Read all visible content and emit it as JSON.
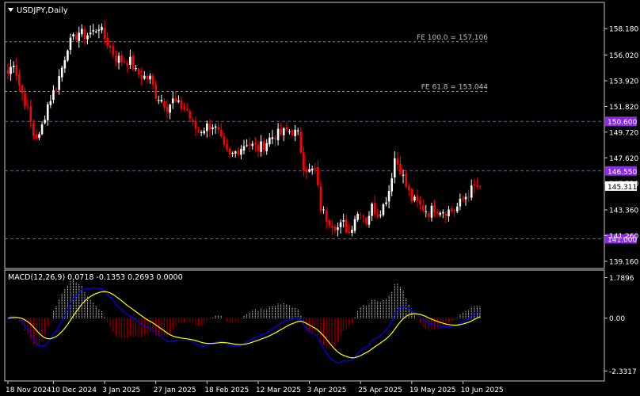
{
  "symbol_title": "USDJPY,Daily",
  "macd_title": "MACD(12,26,9) 0.0718 -0.1353 0.2693 0.0000",
  "colors": {
    "background": "#000000",
    "frame": "#c8c8c8",
    "bull_candle": "#ffffff",
    "bear_candle": "#ff0000",
    "level_line": "#9a34d6",
    "level_label_bg": "#8a2be2",
    "fib_line": "#8c8c8c",
    "macd_line": "#0000ff",
    "signal_line": "#ffff00",
    "hist_pos": "#ffffff",
    "hist_neg": "#ff0000",
    "text": "#ffffff"
  },
  "chart_data": [
    {
      "type": "candlestick",
      "title": "USDJPY,Daily",
      "y_ticks": [
        "158.180",
        "156.020",
        "153.920",
        "151.820",
        "149.720",
        "147.620",
        "145.520",
        "143.360",
        "141.260",
        "139.160"
      ],
      "y_tick_values": [
        158.18,
        156.02,
        153.92,
        151.82,
        149.72,
        147.62,
        145.52,
        143.36,
        141.26,
        139.16
      ],
      "ylim": [
        138.7,
        160.2
      ],
      "x_ticks": [
        "18 Nov 2024",
        "10 Dec 2024",
        "3 Jan 2025",
        "27 Jan 2025",
        "18 Feb 2025",
        "12 Mar 2025",
        "3 Apr 2025",
        "25 Apr 2025",
        "19 May 2025",
        "10 Jun 2025"
      ],
      "x_tick_index": [
        0,
        16,
        34,
        52,
        70,
        88,
        106,
        124,
        142,
        160
      ],
      "current_price": "145.311",
      "current_price_value": 145.311,
      "levels": [
        {
          "label": "150.600",
          "value": 150.6
        },
        {
          "label": "146.550",
          "value": 146.55
        },
        {
          "label": "141.000",
          "value": 141.0
        }
      ],
      "fib_levels": [
        {
          "label": "FE 100.0 = 157.106",
          "value": 157.106
        },
        {
          "label": "FE 61.8 = 153.044",
          "value": 153.044
        }
      ],
      "anchors": [
        [
          0,
          154.5
        ],
        [
          2,
          155.5
        ],
        [
          4,
          153.6
        ],
        [
          7,
          151.5
        ],
        [
          9,
          149.5
        ],
        [
          11,
          149.3
        ],
        [
          14,
          152.0
        ],
        [
          17,
          153.5
        ],
        [
          19,
          155.0
        ],
        [
          21,
          156.8
        ],
        [
          23,
          157.3
        ],
        [
          25,
          157.9
        ],
        [
          27,
          157.6
        ],
        [
          30,
          157.9
        ],
        [
          32,
          158.4
        ],
        [
          34,
          157.4
        ],
        [
          36,
          156.6
        ],
        [
          38,
          155.8
        ],
        [
          40,
          155.6
        ],
        [
          43,
          155.5
        ],
        [
          45,
          154.6
        ],
        [
          47,
          154.3
        ],
        [
          50,
          154.1
        ],
        [
          52,
          152.8
        ],
        [
          54,
          152.4
        ],
        [
          56,
          151.8
        ],
        [
          58,
          152.3
        ],
        [
          60,
          151.9
        ],
        [
          63,
          151.5
        ],
        [
          65,
          150.3
        ],
        [
          67,
          149.8
        ],
        [
          70,
          150.2
        ],
        [
          72,
          150.3
        ],
        [
          74,
          149.6
        ],
        [
          76,
          148.3
        ],
        [
          78,
          147.7
        ],
        [
          80,
          148.1
        ],
        [
          82,
          148.5
        ],
        [
          84,
          148.9
        ],
        [
          86,
          148.6
        ],
        [
          88,
          148.4
        ],
        [
          90,
          148.7
        ],
        [
          92,
          149.2
        ],
        [
          94,
          149.5
        ],
        [
          96,
          149.6
        ],
        [
          98,
          149.8
        ],
        [
          100,
          149.8
        ],
        [
          102,
          149.5
        ],
        [
          104,
          147.0
        ],
        [
          106,
          146.5
        ],
        [
          108,
          146.6
        ],
        [
          110,
          143.5
        ],
        [
          112,
          142.7
        ],
        [
          114,
          142.3
        ],
        [
          116,
          141.9
        ],
        [
          118,
          142.2
        ],
        [
          120,
          141.5
        ],
        [
          122,
          142.8
        ],
        [
          124,
          143.3
        ],
        [
          126,
          142.5
        ],
        [
          128,
          143.6
        ],
        [
          130,
          143.1
        ],
        [
          132,
          143.7
        ],
        [
          134,
          145.0
        ],
        [
          136,
          147.6
        ],
        [
          138,
          146.7
        ],
        [
          140,
          145.3
        ],
        [
          142,
          144.2
        ],
        [
          144,
          143.9
        ],
        [
          146,
          143.5
        ],
        [
          148,
          143.2
        ],
        [
          150,
          143.5
        ],
        [
          152,
          143.4
        ],
        [
          154,
          143.3
        ],
        [
          156,
          143.3
        ],
        [
          158,
          143.6
        ],
        [
          160,
          144.2
        ],
        [
          162,
          144.8
        ],
        [
          164,
          145.2
        ],
        [
          166,
          145.311
        ]
      ]
    },
    {
      "type": "macd",
      "title": "MACD(12,26,9) 0.0718 -0.1353 0.2693 0.0000",
      "y_ticks": [
        "1.7896",
        "0.00",
        "-2.3317"
      ],
      "y_tick_values": [
        1.7896,
        0.0,
        -2.3317
      ],
      "ylim": [
        -2.7,
        2.05
      ],
      "macd_value": 0.0718,
      "signal_value": -0.1353,
      "histogram_value": 0.2693
    }
  ]
}
